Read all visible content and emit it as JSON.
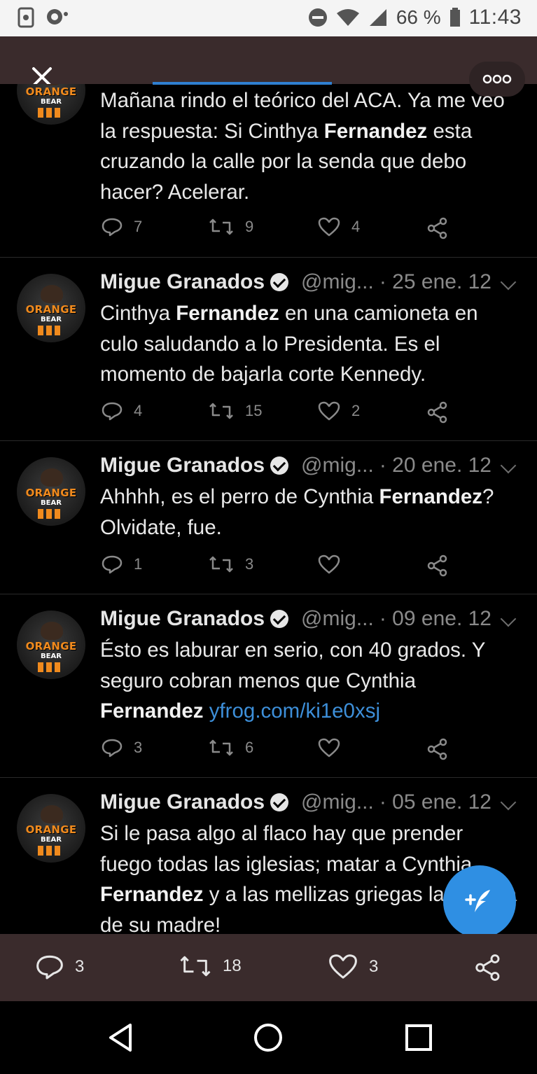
{
  "status_bar": {
    "battery": "66 %",
    "time": "11:43"
  },
  "feed": {
    "tweets": [
      {
        "text_parts": [
          "Mañana rindo el teórico del ACA. Ya me veo la respuesta: Si Cinthya ",
          "Fernandez",
          " esta cruzando la calle por la senda que debo hacer? Acelerar."
        ],
        "replies": "7",
        "retweets": "9",
        "likes": "4"
      },
      {
        "name": "Migue Granados",
        "handle": "@mig...",
        "date": "· 25 ene. 12",
        "text_parts": [
          "Cinthya ",
          "Fernandez",
          " en una camioneta en culo saludando a lo Presidenta. Es el momento de bajarla corte Kennedy."
        ],
        "replies": "4",
        "retweets": "15",
        "likes": "2"
      },
      {
        "name": "Migue Granados",
        "handle": "@mig...",
        "date": "· 20 ene. 12",
        "text_parts": [
          "Ahhhh, es el perro de Cynthia ",
          "Fernandez",
          "? Olvidate, fue."
        ],
        "replies": "1",
        "retweets": "3",
        "likes": ""
      },
      {
        "name": "Migue Granados",
        "handle": "@mig...",
        "date": "· 09 ene. 12",
        "text_parts": [
          "Ésto es laburar en serio, con 40 grados. Y seguro cobran menos que Cynthia ",
          "Fernandez",
          " ",
          "yfrog.com/ki1e0xsj"
        ],
        "replies": "3",
        "retweets": "6",
        "likes": ""
      },
      {
        "name": "Migue Granados",
        "handle": "@mig...",
        "date": "· 05 ene. 12",
        "text_parts": [
          "Si le pasa algo al flaco hay que prender fuego todas las iglesias; matar a Cynthia ",
          "Fernandez",
          " y a las mellizas griegas la concha de su madre!"
        ]
      }
    ]
  },
  "avatar": {
    "line1": "ORANGE",
    "line2": "BEAR"
  },
  "bottom_bar": {
    "replies": "3",
    "retweets": "18",
    "likes": "3"
  },
  "colors": {
    "accent": "#2f8fe3",
    "link": "#3d8fd9",
    "bar": "#3a2b2c"
  },
  "icons": [
    "close-icon",
    "more-icon",
    "reply-icon",
    "retweet-icon",
    "like-icon",
    "share-icon",
    "compose-icon",
    "back-icon",
    "home-icon",
    "recents-icon"
  ]
}
